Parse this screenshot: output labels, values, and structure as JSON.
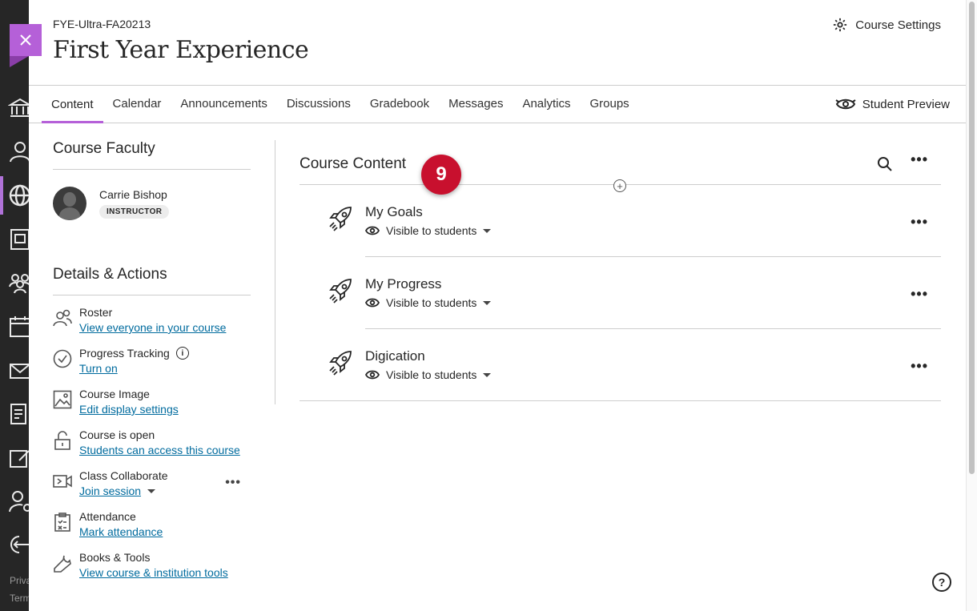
{
  "leftnav": {
    "icons": [
      "institution-icon",
      "profile-icon",
      "globe-icon",
      "courses-icon",
      "organizations-icon",
      "calendar-icon",
      "messages-icon",
      "grades-icon",
      "tools-icon",
      "admin-icon",
      "sign-out-icon"
    ],
    "footer": [
      "Priva",
      "Term"
    ]
  },
  "header": {
    "course_id": "FYE-Ultra-FA20213",
    "course_title": "First Year Experience",
    "settings_label": "Course Settings"
  },
  "tabs": [
    {
      "label": "Content",
      "active": true
    },
    {
      "label": "Calendar"
    },
    {
      "label": "Announcements"
    },
    {
      "label": "Discussions"
    },
    {
      "label": "Gradebook"
    },
    {
      "label": "Messages"
    },
    {
      "label": "Analytics"
    },
    {
      "label": "Groups"
    }
  ],
  "student_preview_label": "Student Preview",
  "faculty": {
    "heading": "Course Faculty",
    "name": "Carrie Bishop",
    "role": "INSTRUCTOR"
  },
  "details": {
    "heading": "Details & Actions",
    "items": [
      {
        "title": "Roster",
        "link": "View everyone in your course",
        "icon": "roster-icon"
      },
      {
        "title": "Progress Tracking",
        "link": "Turn on",
        "icon": "progress-check-icon"
      },
      {
        "title": "Course Image",
        "link": "Edit display settings",
        "icon": "image-icon"
      },
      {
        "title": "Course is open",
        "link": "Students can access this course",
        "icon": "unlock-icon"
      },
      {
        "title": "Class Collaborate",
        "link": "Join session",
        "icon": "video-icon"
      },
      {
        "title": "Attendance",
        "link": "Mark attendance",
        "icon": "attendance-icon"
      },
      {
        "title": "Books & Tools",
        "link": "View course & institution tools",
        "icon": "wrench-icon"
      }
    ]
  },
  "content": {
    "heading": "Course Content",
    "step_number": "9",
    "items": [
      {
        "title": "My Goals",
        "visibility": "Visible to students"
      },
      {
        "title": "My Progress",
        "visibility": "Visible to students"
      },
      {
        "title": "Digication",
        "visibility": "Visible to students"
      }
    ]
  },
  "accent_color": "#b560d8",
  "link_color": "#006b9e",
  "step_badge_color": "#c8102e"
}
